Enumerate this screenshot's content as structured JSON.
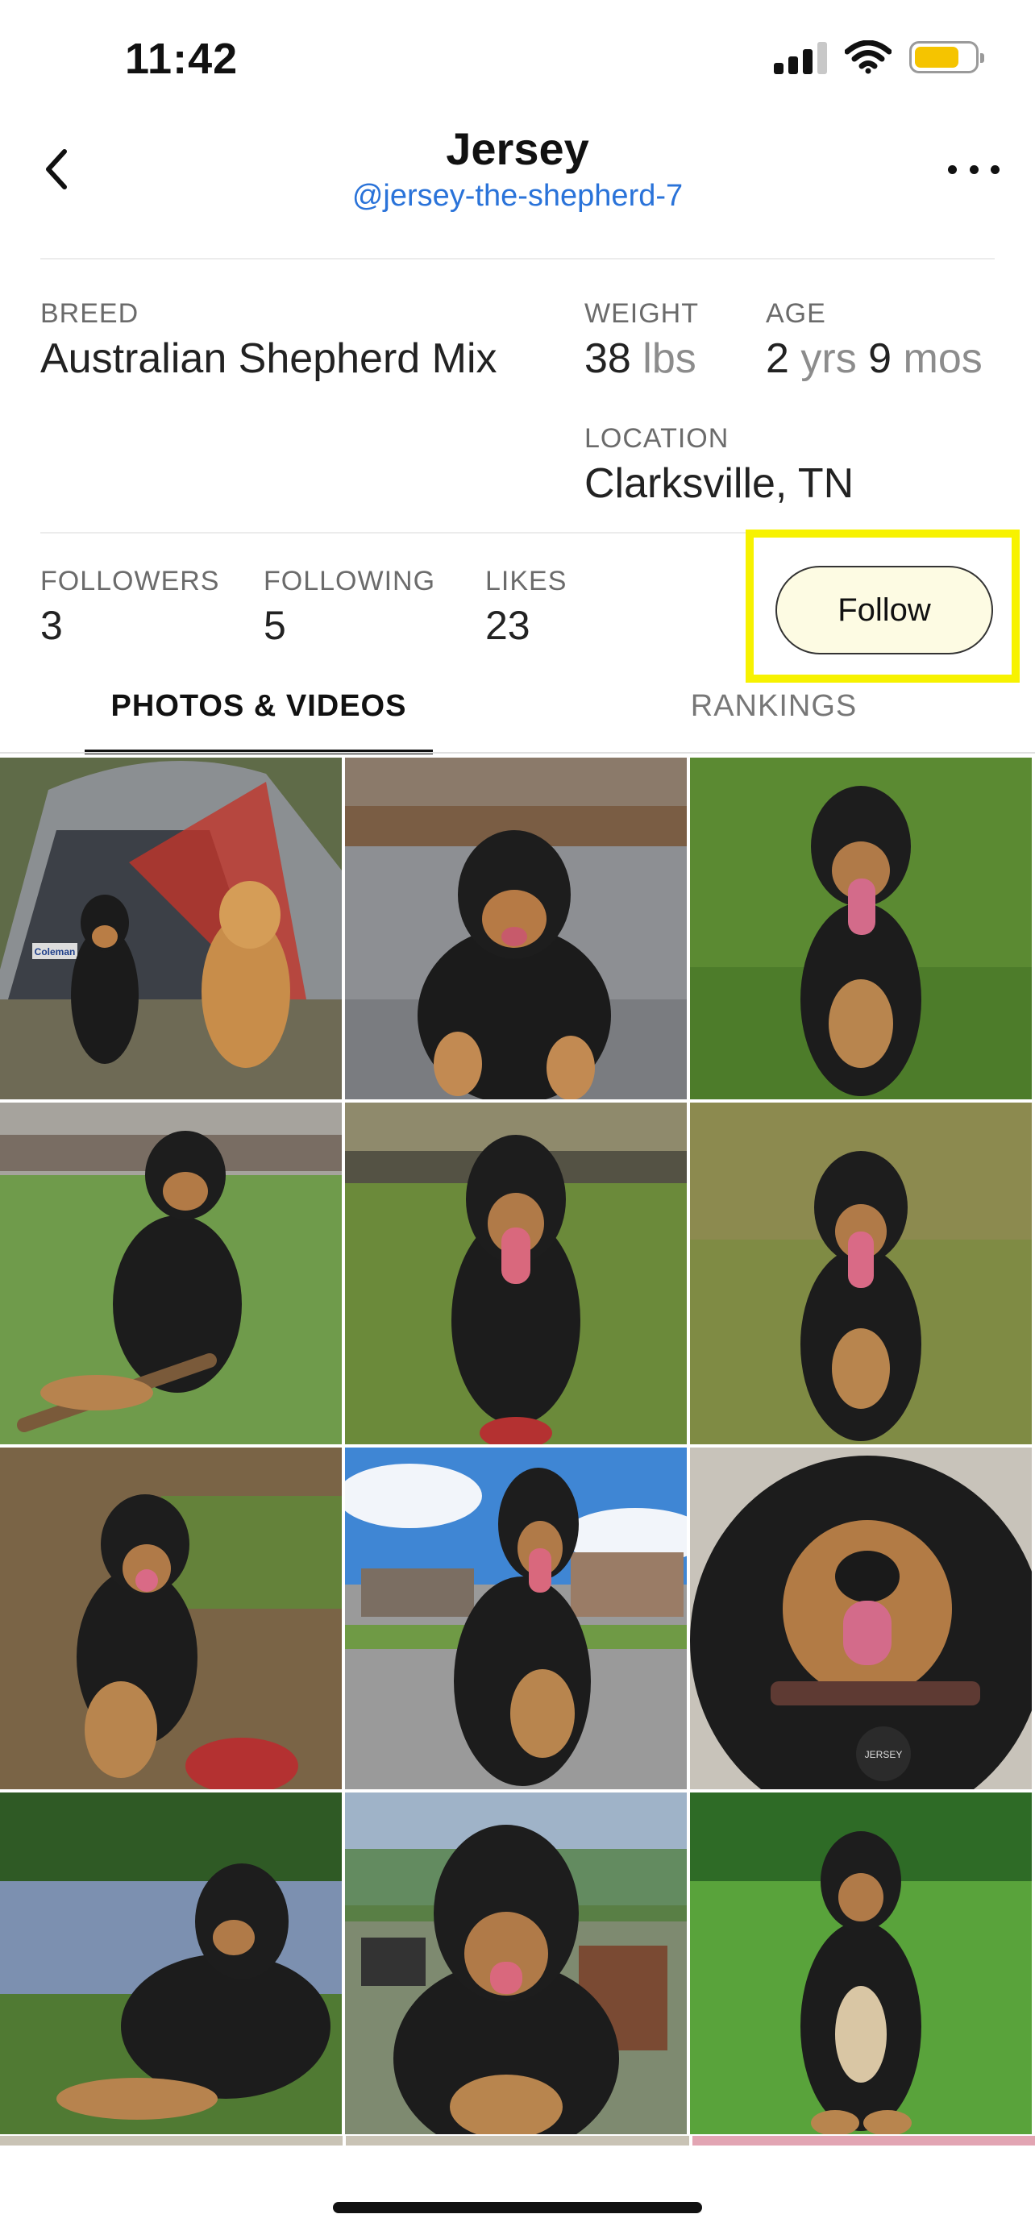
{
  "status_bar": {
    "time": "11:42",
    "signal_icon": "cellular-signal-icon",
    "wifi_icon": "wifi-icon",
    "battery_icon": "battery-icon",
    "battery_level": 0.7
  },
  "header": {
    "title": "Jersey",
    "handle": "@jersey-the-shepherd-7",
    "back_icon": "chevron-left-icon",
    "more_icon": "more-horizontal-icon"
  },
  "details": {
    "breed_label": "BREED",
    "breed_value": "Australian Shepherd Mix",
    "weight_label": "WEIGHT",
    "weight_number": "38",
    "weight_unit": "lbs",
    "age_label": "AGE",
    "age_years": "2",
    "age_years_unit": "yrs",
    "age_months": "9",
    "age_months_unit": "mos",
    "location_label": "LOCATION",
    "location_value": "Clarksville, TN"
  },
  "stats": {
    "followers_label": "FOLLOWERS",
    "followers_value": "3",
    "following_label": "FOLLOWING",
    "following_value": "5",
    "likes_label": "LIKES",
    "likes_value": "23"
  },
  "actions": {
    "follow_label": "Follow",
    "highlight_color": "#f7f200"
  },
  "tabs": [
    {
      "label": "PHOTOS & VIDEOS",
      "active": true
    },
    {
      "label": "RANKINGS",
      "active": false
    }
  ],
  "photo_watermark": "Coleman",
  "photo_tag": "JERSEY"
}
